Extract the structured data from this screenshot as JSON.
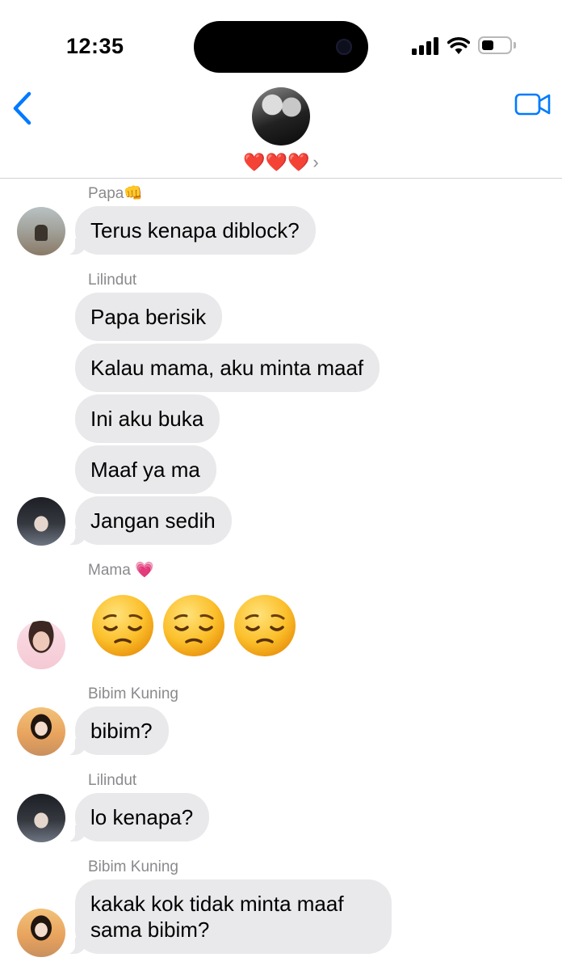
{
  "status_bar": {
    "time": "12:35"
  },
  "header": {
    "group_name": "❤️❤️❤️",
    "chevron": "›"
  },
  "icons": {
    "back": "chevron-left-icon",
    "video": "video-camera-icon",
    "signal": "cellular-signal-icon",
    "wifi": "wifi-icon",
    "battery": "battery-icon"
  },
  "colors": {
    "accent": "#007aff",
    "bubble": "#e9e9eb",
    "sender": "#8a8a8e"
  },
  "messages": [
    {
      "sender": "Papa👊",
      "texts": [
        "Terus kenapa diblock?"
      ]
    },
    {
      "sender": "Lilindut",
      "texts": [
        "Papa berisik",
        "Kalau mama, aku minta maaf",
        "Ini aku buka",
        "Maaf ya ma",
        "Jangan sedih"
      ]
    },
    {
      "sender": "Mama 💗",
      "emoji": [
        "😔",
        "😔",
        "😔"
      ]
    },
    {
      "sender": "Bibim Kuning",
      "texts": [
        "bibim?"
      ]
    },
    {
      "sender": "Lilindut",
      "texts": [
        "lo kenapa?"
      ]
    },
    {
      "sender": "Bibim Kuning",
      "texts": [
        "kakak kok tidak minta maaf sama bibim?"
      ]
    }
  ]
}
